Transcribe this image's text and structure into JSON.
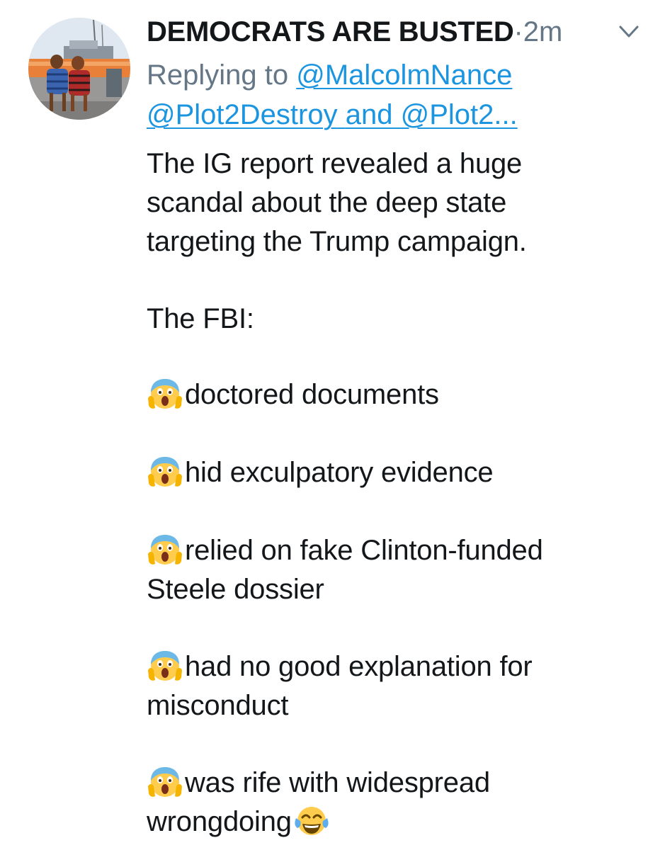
{
  "tweet": {
    "display_name": "DEMOCRATS ARE BUSTED",
    "separator": "·",
    "timestamp": "2m",
    "menu_icon": "chevron-down-icon",
    "reply": {
      "prefix": "Replying to",
      "mention_1": "@MalcolmNance",
      "mention_2": "@Plot2Destroy",
      "conjunction": "and",
      "mention_3": "@Plot2..."
    },
    "body": {
      "intro_lines": [
        "The IG report revealed a huge",
        "scandal about the deep state",
        "targeting the Trump campaign."
      ],
      "heading": "The FBI:",
      "items": [
        {
          "lines": [
            "doctored documents"
          ]
        },
        {
          "lines": [
            "hid exculpatory evidence"
          ]
        },
        {
          "lines": [
            "relied on fake Clinton-funded",
            "Steele dossier"
          ]
        },
        {
          "lines": [
            "had no good explanation for",
            "misconduct"
          ]
        },
        {
          "lines": [
            "was rife with widespread",
            "wrongdoing"
          ]
        }
      ],
      "item_emoji": "screaming-face-emoji",
      "closing_emoji": "tears-of-joy-emoji"
    },
    "colors": {
      "text": "#14171a",
      "muted": "#657786",
      "link": "#1b95e0"
    }
  }
}
